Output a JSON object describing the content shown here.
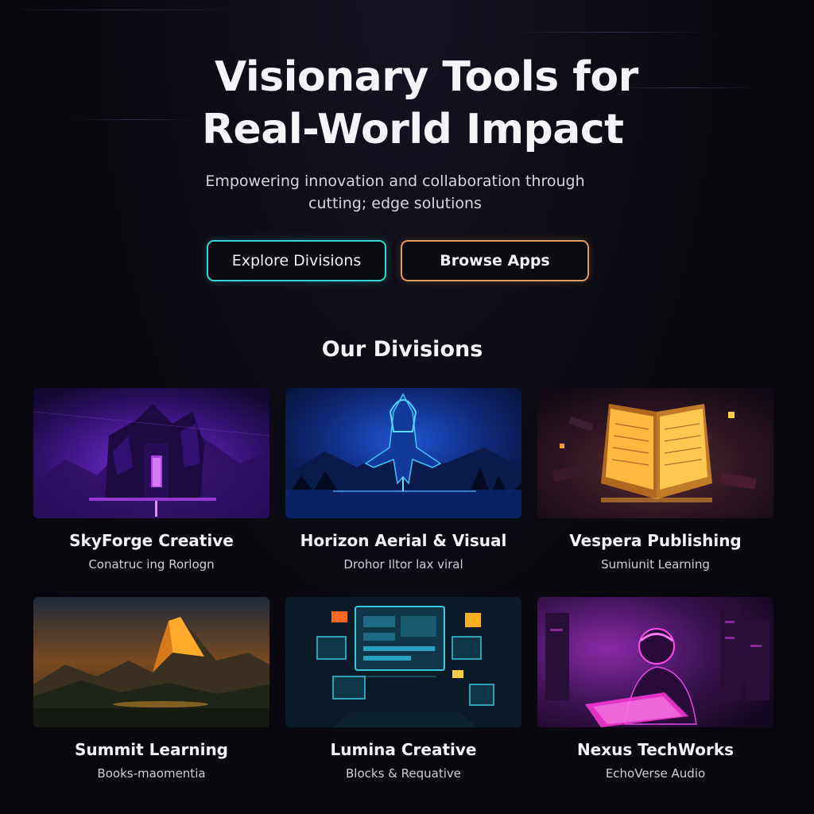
{
  "hero": {
    "title_line1": "Visionary Tools for",
    "title_line2": "Real-World Impact",
    "subtitle_line1": "Empowering innovation and collaboration through",
    "subtitle_line2": "cutting; edge solutions",
    "explore_label": "Explore Divisions",
    "browse_label": "Browse Apps"
  },
  "divisions": {
    "heading": "Our Divisions",
    "items": [
      {
        "name": "SkyForge Creative",
        "desc": "Conatruc ing Rorlogn",
        "image": "purple-fortress-image"
      },
      {
        "name": "Horizon Aerial & Visual",
        "desc": "Drohor Iltor lax viral",
        "image": "blue-aircraft-image"
      },
      {
        "name": "Vespera Publishing",
        "desc": "Sumiunit Learning",
        "image": "glowing-book-image"
      },
      {
        "name": "Summit Learning",
        "desc": "Books-maomentia",
        "image": "mountain-sunset-image"
      },
      {
        "name": "Lumina Creative",
        "desc": "Blocks & Requative",
        "image": "holographic-screens-image"
      },
      {
        "name": "Nexus TechWorks",
        "desc": "EchoVerse Audio",
        "image": "neon-person-keyboard-image"
      }
    ]
  },
  "colors": {
    "background": "#08070d",
    "explore_border": "#2fd6d2",
    "browse_border": "#e69a63",
    "text": "#f4f4f8"
  }
}
